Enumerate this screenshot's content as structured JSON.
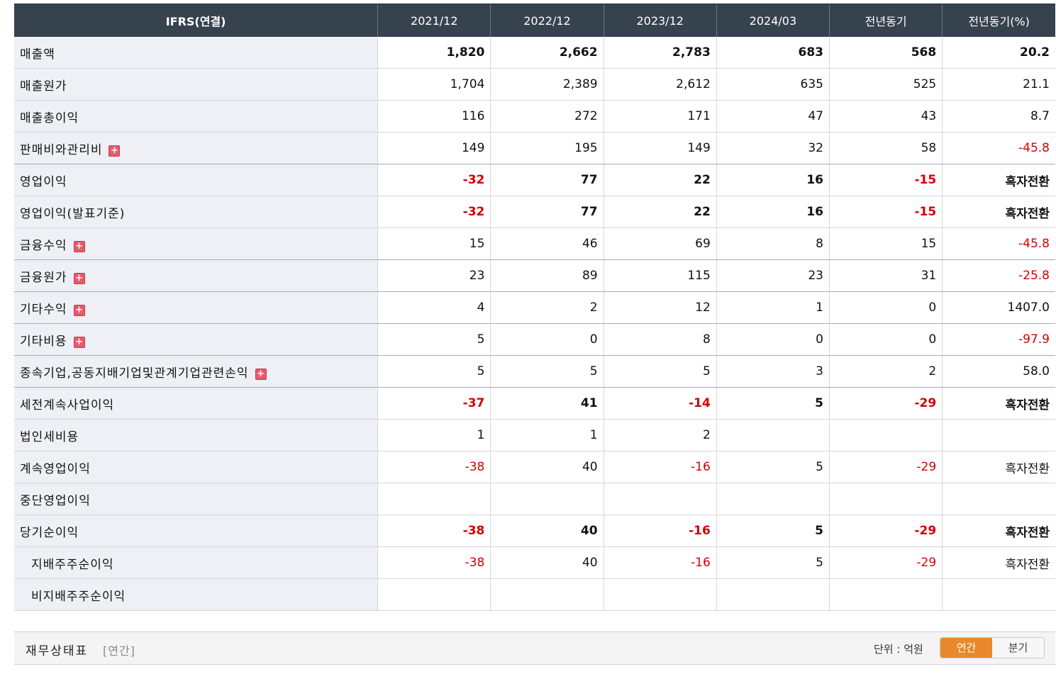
{
  "table": {
    "headers": [
      "IFRS(연결)",
      "2021/12",
      "2022/12",
      "2023/12",
      "2024/03",
      "전년동기",
      "전년동기(%)"
    ],
    "rows": [
      {
        "label": "매출액",
        "values": [
          "1,820",
          "2,662",
          "2,783",
          "683",
          "568",
          "20.2"
        ],
        "bold": true,
        "expand": false,
        "indent": false
      },
      {
        "label": "매출원가",
        "values": [
          "1,704",
          "2,389",
          "2,612",
          "635",
          "525",
          "21.1"
        ],
        "bold": false,
        "expand": false,
        "indent": false
      },
      {
        "label": "매출총이익",
        "values": [
          "116",
          "272",
          "171",
          "47",
          "43",
          "8.7"
        ],
        "bold": false,
        "expand": false,
        "indent": false
      },
      {
        "label": "판매비와관리비",
        "values": [
          "149",
          "195",
          "149",
          "32",
          "58",
          "-45.8"
        ],
        "bold": false,
        "expand": true,
        "indent": false,
        "sep": true
      },
      {
        "label": "영업이익",
        "values": [
          "-32",
          "77",
          "22",
          "16",
          "-15",
          "흑자전환"
        ],
        "bold": true,
        "expand": false,
        "indent": false
      },
      {
        "label": "영업이익(발표기준)",
        "values": [
          "-32",
          "77",
          "22",
          "16",
          "-15",
          "흑자전환"
        ],
        "bold": true,
        "expand": false,
        "indent": false
      },
      {
        "label": "금융수익",
        "values": [
          "15",
          "46",
          "69",
          "8",
          "15",
          "-45.8"
        ],
        "bold": false,
        "expand": true,
        "indent": false,
        "sep": true
      },
      {
        "label": "금융원가",
        "values": [
          "23",
          "89",
          "115",
          "23",
          "31",
          "-25.8"
        ],
        "bold": false,
        "expand": true,
        "indent": false,
        "sep": true
      },
      {
        "label": "기타수익",
        "values": [
          "4",
          "2",
          "12",
          "1",
          "0",
          "1407.0"
        ],
        "bold": false,
        "expand": true,
        "indent": false,
        "sep": true
      },
      {
        "label": "기타비용",
        "values": [
          "5",
          "0",
          "8",
          "0",
          "0",
          "-97.9"
        ],
        "bold": false,
        "expand": true,
        "indent": false,
        "sep": true
      },
      {
        "label": "종속기업,공동지배기업및관계기업관련손익",
        "values": [
          "5",
          "5",
          "5",
          "3",
          "2",
          "58.0"
        ],
        "bold": false,
        "expand": true,
        "indent": false,
        "sep": true
      },
      {
        "label": "세전계속사업이익",
        "values": [
          "-37",
          "41",
          "-14",
          "5",
          "-29",
          "흑자전환"
        ],
        "bold": true,
        "expand": false,
        "indent": false
      },
      {
        "label": "법인세비용",
        "values": [
          "1",
          "1",
          "2",
          "",
          "",
          ""
        ],
        "bold": false,
        "expand": false,
        "indent": false
      },
      {
        "label": "계속영업이익",
        "values": [
          "-38",
          "40",
          "-16",
          "5",
          "-29",
          "흑자전환"
        ],
        "bold": false,
        "expand": false,
        "indent": false
      },
      {
        "label": "중단영업이익",
        "values": [
          "",
          "",
          "",
          "",
          "",
          ""
        ],
        "bold": false,
        "expand": false,
        "indent": false
      },
      {
        "label": "당기순이익",
        "values": [
          "-38",
          "40",
          "-16",
          "5",
          "-29",
          "흑자전환"
        ],
        "bold": true,
        "expand": false,
        "indent": false
      },
      {
        "label": "지배주주순이익",
        "values": [
          "-38",
          "40",
          "-16",
          "5",
          "-29",
          "흑자전환"
        ],
        "bold": false,
        "expand": false,
        "indent": true
      },
      {
        "label": "비지배주주순이익",
        "values": [
          "",
          "",
          "",
          "",
          "",
          ""
        ],
        "bold": false,
        "expand": false,
        "indent": true
      }
    ],
    "expand_symbol": "+"
  },
  "footer": {
    "title": "재무상태표",
    "period": "[연간]",
    "unit": "단위 : 억원",
    "toggle_annual": "연간",
    "toggle_quarter": "분기"
  },
  "colors": {
    "header_bg": "#37424f",
    "label_bg": "#eef0f5",
    "negative": "#d50000",
    "toggle_active": "#e8892e"
  }
}
